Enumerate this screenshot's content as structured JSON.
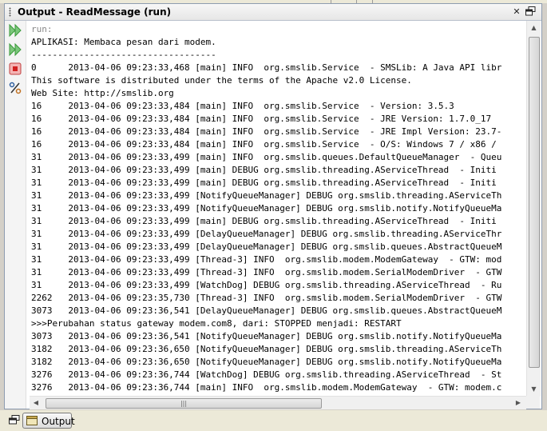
{
  "panel": {
    "title": "Output - ReadMessage (run)"
  },
  "bottom": {
    "tab_label": "Output"
  },
  "console": {
    "lines": [
      "run:",
      "APLIKASI: Membaca pesan dari modem.",
      "-----------------------------------",
      "0      2013-04-06 09:23:33,468 [main] INFO  org.smslib.Service  - SMSLib: A Java API libr",
      "This software is distributed under the terms of the Apache v2.0 License.",
      "Web Site: http://smslib.org",
      "16     2013-04-06 09:23:33,484 [main] INFO  org.smslib.Service  - Version: 3.5.3",
      "16     2013-04-06 09:23:33,484 [main] INFO  org.smslib.Service  - JRE Version: 1.7.0_17",
      "16     2013-04-06 09:23:33,484 [main] INFO  org.smslib.Service  - JRE Impl Version: 23.7-",
      "16     2013-04-06 09:23:33,484 [main] INFO  org.smslib.Service  - O/S: Windows 7 / x86 /",
      "31     2013-04-06 09:23:33,499 [main] INFO  org.smslib.queues.DefaultQueueManager  - Queu",
      "31     2013-04-06 09:23:33,499 [main] DEBUG org.smslib.threading.AServiceThread  - Initi",
      "31     2013-04-06 09:23:33,499 [main] DEBUG org.smslib.threading.AServiceThread  - Initi",
      "31     2013-04-06 09:23:33,499 [NotifyQueueManager] DEBUG org.smslib.threading.AServiceTh",
      "31     2013-04-06 09:23:33,499 [NotifyQueueManager] DEBUG org.smslib.notify.NotifyQueueMa",
      "31     2013-04-06 09:23:33,499 [main] DEBUG org.smslib.threading.AServiceThread  - Initi",
      "31     2013-04-06 09:23:33,499 [DelayQueueManager] DEBUG org.smslib.threading.AServiceThr",
      "31     2013-04-06 09:23:33,499 [DelayQueueManager] DEBUG org.smslib.queues.AbstractQueueM",
      "31     2013-04-06 09:23:33,499 [Thread-3] INFO  org.smslib.modem.ModemGateway  - GTW: mod",
      "31     2013-04-06 09:23:33,499 [Thread-3] INFO  org.smslib.modem.SerialModemDriver  - GTW",
      "31     2013-04-06 09:23:33,499 [WatchDog] DEBUG org.smslib.threading.AServiceThread  - Ru",
      "2262   2013-04-06 09:23:35,730 [Thread-3] INFO  org.smslib.modem.SerialModemDriver  - GTW",
      "3073   2013-04-06 09:23:36,541 [DelayQueueManager] DEBUG org.smslib.queues.AbstractQueueM",
      ">>>Perubahan status gateway modem.com8, dari: STOPPED menjadi: RESTART",
      "3073   2013-04-06 09:23:36,541 [NotifyQueueManager] DEBUG org.smslib.notify.NotifyQueueMa",
      "3182   2013-04-06 09:23:36,650 [NotifyQueueManager] DEBUG org.smslib.threading.AServiceTh",
      "3182   2013-04-06 09:23:36,650 [NotifyQueueManager] DEBUG org.smslib.notify.NotifyQueueMa",
      "3276   2013-04-06 09:23:36,744 [WatchDog] DEBUG org.smslib.threading.AServiceThread  - St",
      "3276   2013-04-06 09:23:36,744 [main] INFO  org.smslib.modem.ModemGateway  - GTW: modem.c"
    ]
  },
  "icons": {
    "rerun": "double-play-icon",
    "rerun_with_options": "double-play-icon",
    "stop": "stop-icon",
    "settings": "gear-percent-icon",
    "close": "close-icon",
    "maximize": "maximize-icon",
    "restore": "restore-icon",
    "output_tab": "output-window-icon"
  },
  "colors": {
    "accent_green": "#3a9a3a",
    "stop_red": "#d02020",
    "panel_border": "#8e9cb0"
  }
}
